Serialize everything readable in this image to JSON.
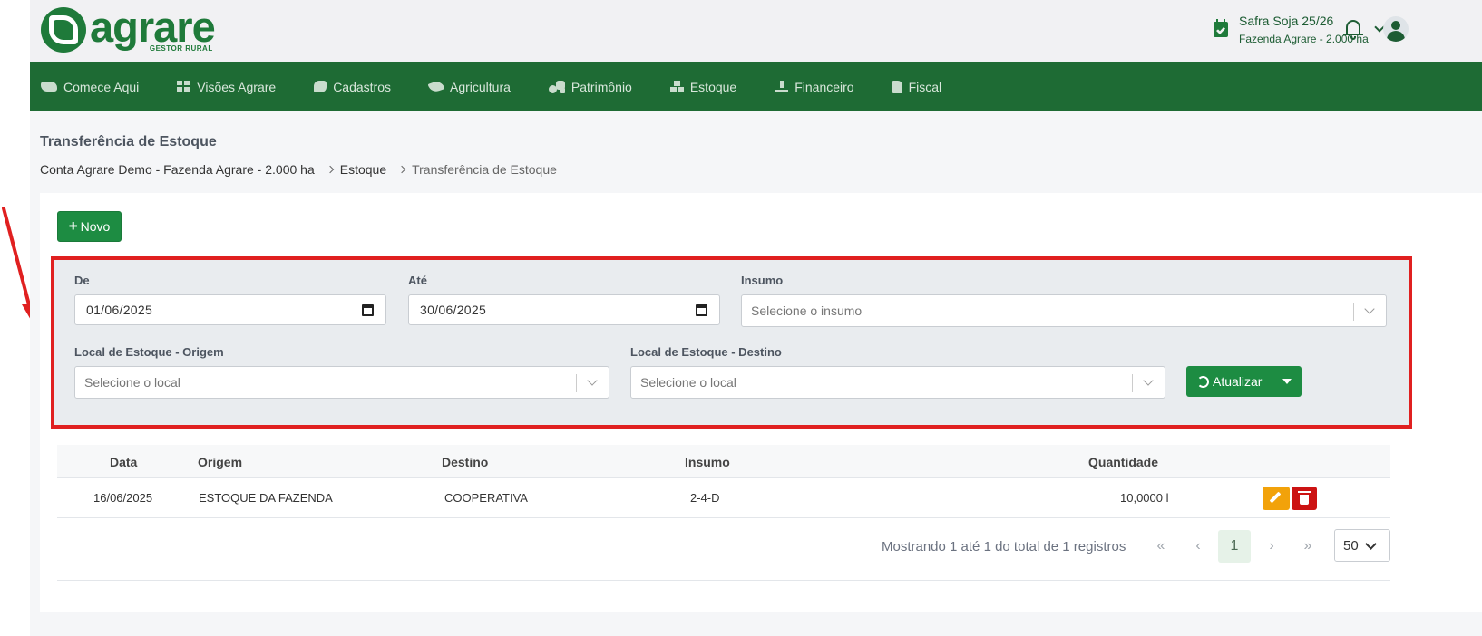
{
  "header": {
    "logo_word": "agrare",
    "logo_sub": "GESTOR RURAL",
    "season_name": "Safra Soja 25/26",
    "season_farm": "Fazenda Agrare - 2.000 ha"
  },
  "nav": {
    "items": [
      {
        "label": "Comece Aqui",
        "icon": "handshake-icon"
      },
      {
        "label": "Visões Agrare",
        "icon": "grid-icon"
      },
      {
        "label": "Cadastros",
        "icon": "cow-icon"
      },
      {
        "label": "Agricultura",
        "icon": "leaf-icon"
      },
      {
        "label": "Patrimônio",
        "icon": "tractor-icon"
      },
      {
        "label": "Estoque",
        "icon": "boxes-icon"
      },
      {
        "label": "Financeiro",
        "icon": "money-hand-icon"
      },
      {
        "label": "Fiscal",
        "icon": "file-icon"
      }
    ]
  },
  "page": {
    "title": "Transferência de Estoque",
    "breadcrumb": [
      "Conta Agrare Demo - Fazenda Agrare - 2.000 ha",
      "Estoque",
      "Transferência de Estoque"
    ]
  },
  "toolbar": {
    "new_label": "Novo"
  },
  "filters": {
    "from_label": "De",
    "from_value": "01/06/2025",
    "to_label": "Até",
    "to_value": "30/06/2025",
    "input_label": "Insumo",
    "input_placeholder": "Selecione o insumo",
    "origin_label": "Local de Estoque - Origem",
    "origin_placeholder": "Selecione o local",
    "dest_label": "Local de Estoque - Destino",
    "dest_placeholder": "Selecione o local",
    "refresh_label": "Atualizar"
  },
  "table": {
    "headers": [
      "Data",
      "Origem",
      "Destino",
      "Insumo",
      "Quantidade"
    ],
    "rows": [
      {
        "data": "16/06/2025",
        "origem": "ESTOQUE DA FAZENDA",
        "destino": "COOPERATIVA",
        "insumo": "2-4-D",
        "quantidade": "10,0000 l"
      }
    ]
  },
  "pagination": {
    "info": "Mostrando 1 até 1 do total de 1 registros",
    "first": "«",
    "prev": "‹",
    "current": "1",
    "next": "›",
    "last": "»",
    "per_page": "50"
  },
  "colors": {
    "brand_green": "#1e6b34",
    "button_green": "#1d8c42",
    "highlight_red": "#e02020",
    "edit_orange": "#f2a20a",
    "delete_red": "#cc1313"
  }
}
